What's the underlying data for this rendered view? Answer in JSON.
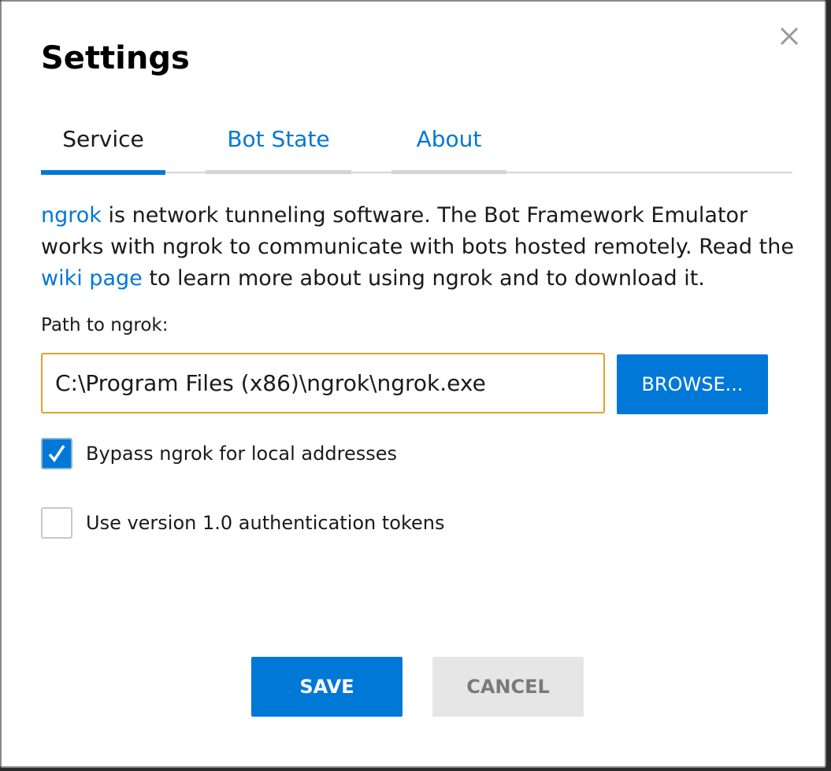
{
  "dialog": {
    "title": "Settings",
    "close_icon": "close-icon"
  },
  "tabs": [
    {
      "label": "Service",
      "active": true
    },
    {
      "label": "Bot State",
      "active": false
    },
    {
      "label": "About",
      "active": false
    }
  ],
  "service": {
    "description": {
      "link_ngrok": "ngrok",
      "text_1": " is network tunneling software. The Bot Framework Emulator works with ngrok to communicate with bots hosted remotely. Read the ",
      "link_wiki": "wiki page",
      "text_2": " to learn more about using ngrok and to download it."
    },
    "path_label": "Path to ngrok:",
    "path_value": "C:\\Program Files (x86)\\ngrok\\ngrok.exe",
    "browse_label": "BROWSE...",
    "bypass": {
      "label": "Bypass ngrok for local addresses",
      "checked": true
    },
    "use_v1": {
      "label": "Use version 1.0 authentication tokens",
      "checked": false
    }
  },
  "buttons": {
    "save": "SAVE",
    "cancel": "CANCEL"
  },
  "colors": {
    "accent": "#0078d7",
    "input_focus_border": "#e3a02b",
    "cancel_bg": "#e6e6e6"
  }
}
